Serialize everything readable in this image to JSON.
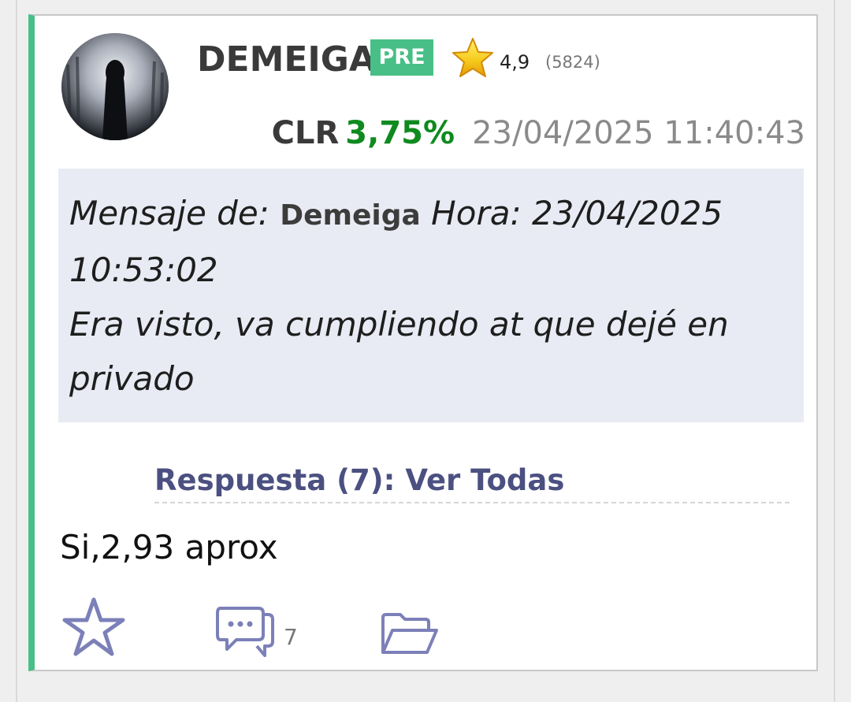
{
  "post": {
    "username": "DEMEIGA",
    "badge": "PRE",
    "rating": "4,9",
    "rating_count": "(5824)",
    "ticker": "CLR",
    "change_pct": "3,75%",
    "timestamp": "23/04/2025 11:40:43",
    "quote": {
      "prefix": "Mensaje de: ",
      "author": "Demeiga",
      "time_label": " Hora: 23/04/2025 10:53:02",
      "text": "Era visto, va cumpliendo at que dejé en privado"
    },
    "replies_link": "Respuesta (7): Ver Todas",
    "reply_text": "Si,2,93 aprox",
    "comment_count": "7"
  },
  "colors": {
    "accent": "#48bf86",
    "positive": "#0f8a1f",
    "link": "#4b5081",
    "icon": "#7c80b8"
  },
  "icons": {
    "rating": "star-icon",
    "favorite": "star-outline-icon",
    "comments": "comments-icon",
    "folder": "folder-open-icon"
  }
}
